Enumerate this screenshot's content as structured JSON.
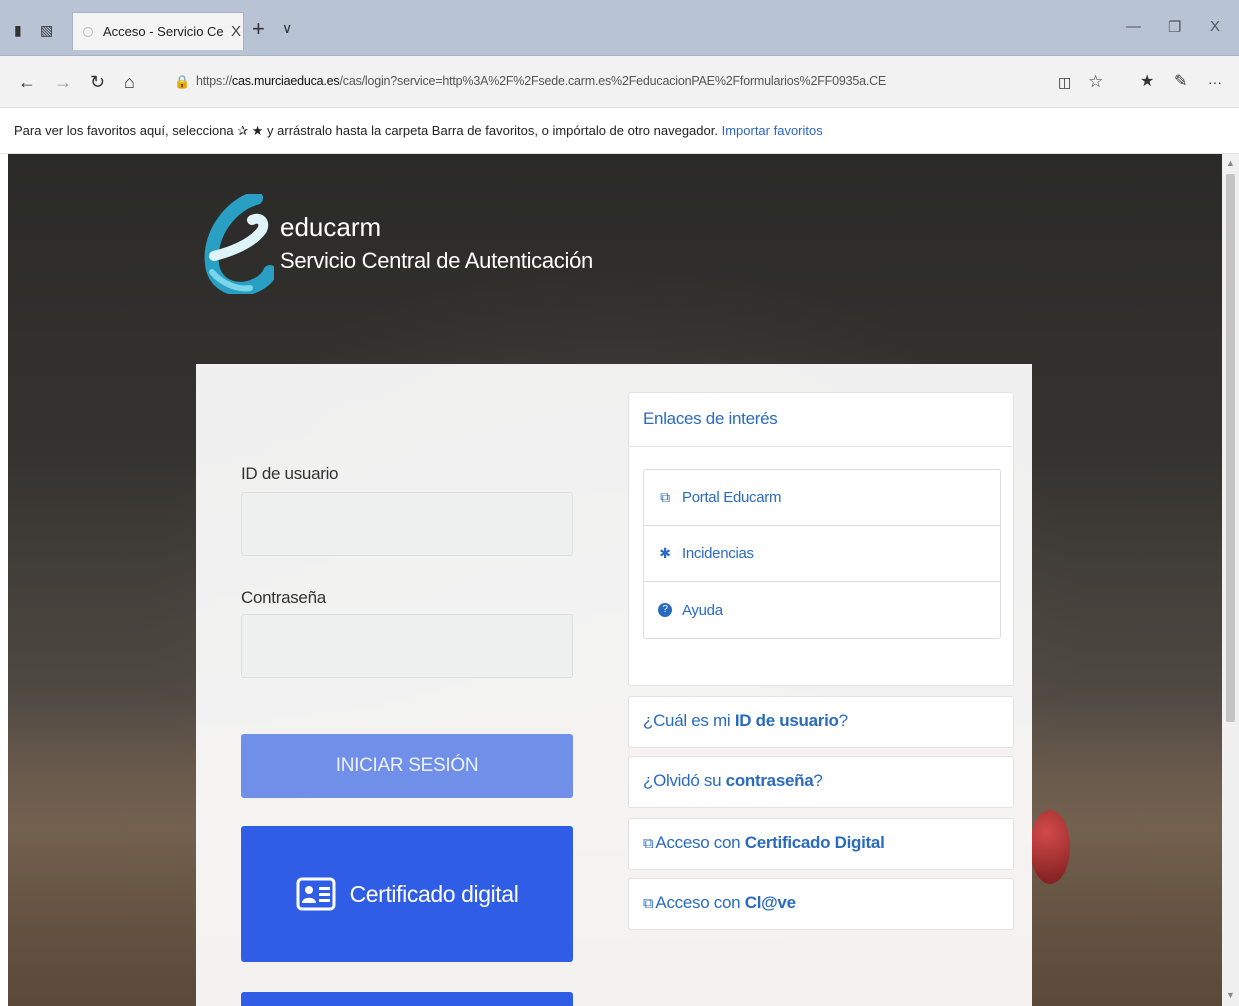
{
  "browser": {
    "tab_title": "Acceso - Servicio Centrá",
    "tab_close": "X",
    "new_tab": "+",
    "tab_menu": "∨",
    "win_minimize": "—",
    "win_restore": "❐",
    "win_close": "X",
    "nav": {
      "back": "←",
      "forward": "→",
      "refresh": "↻",
      "home": "⌂"
    },
    "url_prefix": "https://",
    "url_host": "cas.murciaeduca.es",
    "url_path": "/cas/login?service=http%3A%2F%2Fsede.carm.es%2FeducacionPAE%2Fformularios%2FF0935a.CE",
    "toolbar_icons": [
      "reading-view-icon",
      "favorite-star-icon",
      "favorites-hub-icon",
      "pen-icon",
      "more-icon"
    ],
    "favbar_text": "Para ver los favoritos aquí, selecciona ✰ ★ y arrástralo hasta la carpeta Barra de favoritos, o impórtalo de otro navegador.",
    "favbar_link": "Importar favoritos"
  },
  "brand": {
    "name": "educarm",
    "subtitle": "Servicio Central de Autenticación",
    "colors": {
      "logo_light": "#7ad6e8",
      "logo_dark": "#2a9fc4"
    }
  },
  "login": {
    "user_label": "ID de usuario",
    "user_value": "",
    "password_label": "Contraseña",
    "password_value": "",
    "login_button": "INICIAR SESIÓN",
    "cert_button": "Certificado digital",
    "colors": {
      "login_btn": "#6f8fe9",
      "cert_btn": "#2f5de5"
    }
  },
  "links": {
    "title": "Enlaces de interés",
    "items": [
      {
        "icon": "external-link-icon",
        "label": "Portal Educarm"
      },
      {
        "icon": "bug-icon",
        "label": "Incidencias"
      },
      {
        "icon": "help-icon",
        "label": "Ayuda"
      }
    ]
  },
  "help": {
    "q1_pre": "¿Cuál es mi ",
    "q1_bold": "ID de usuario",
    "q1_post": "?",
    "q2_pre": "¿Olvidó su ",
    "q2_bold": "contraseña",
    "q2_post": "?",
    "cert_pre": "Acceso con ",
    "cert_bold": "Certificado Digital",
    "clave_pre": "Acceso con ",
    "clave_bold": "Cl@ve"
  },
  "accent_color": "#2a6bc0"
}
